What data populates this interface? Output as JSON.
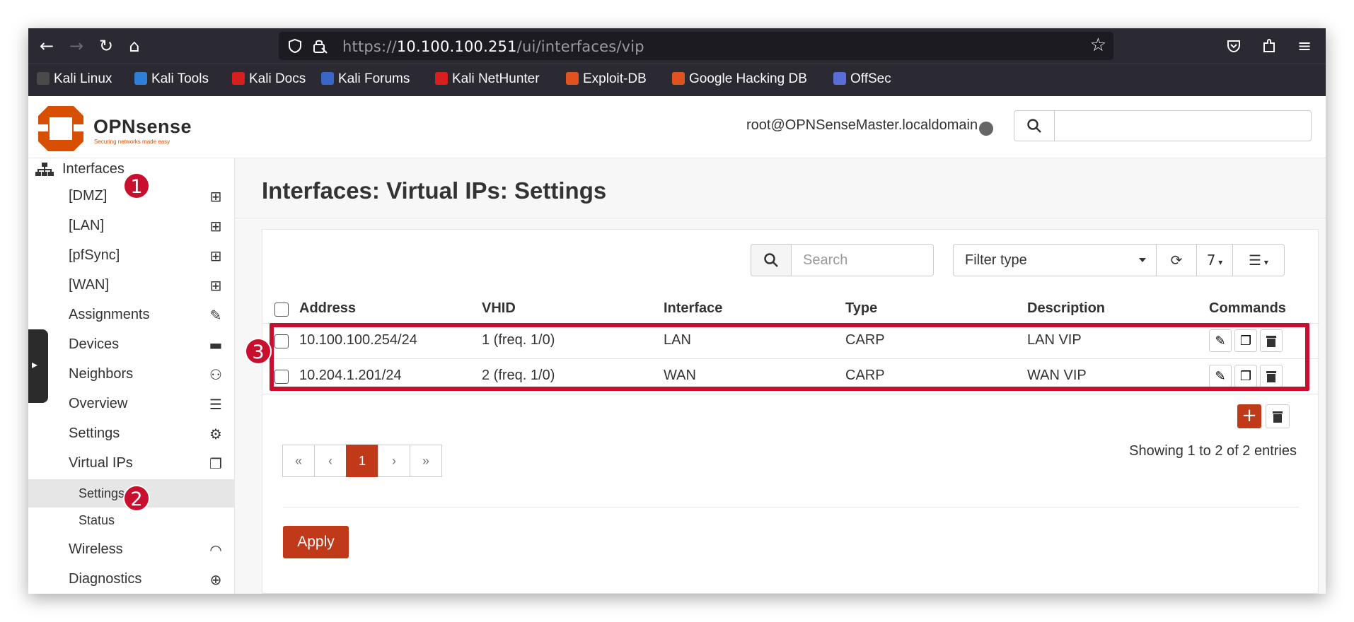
{
  "browser": {
    "url_prefix": "https://",
    "url_host": "10.100.100.251",
    "url_path": "/ui/interfaces/vip",
    "bookmarks": [
      {
        "label": "Kali Linux",
        "color": "#4a4a4a"
      },
      {
        "label": "Kali Tools",
        "color": "#2f7fd8"
      },
      {
        "label": "Kali Docs",
        "color": "#d61f1f"
      },
      {
        "label": "Kali Forums",
        "color": "#3a66c8"
      },
      {
        "label": "Kali NetHunter",
        "color": "#d61f1f"
      },
      {
        "label": "Exploit-DB",
        "color": "#e0531f"
      },
      {
        "label": "Google Hacking DB",
        "color": "#e0531f"
      },
      {
        "label": "OffSec",
        "color": "#5a6ed8"
      }
    ]
  },
  "header": {
    "logo_name": "OPNsense",
    "logo_tagline": "Securing networks made easy",
    "user": "root@OPNSenseMaster.localdomain"
  },
  "sidebar": {
    "section": "Interfaces",
    "items": [
      {
        "label": "[DMZ]"
      },
      {
        "label": "[LAN]"
      },
      {
        "label": "[pfSync]"
      },
      {
        "label": "[WAN]"
      },
      {
        "label": "Assignments"
      },
      {
        "label": "Devices"
      },
      {
        "label": "Neighbors"
      },
      {
        "label": "Overview"
      },
      {
        "label": "Settings"
      },
      {
        "label": "Virtual IPs"
      },
      {
        "label": "Settings"
      },
      {
        "label": "Status"
      },
      {
        "label": "Wireless"
      },
      {
        "label": "Diagnostics"
      }
    ]
  },
  "main": {
    "title": "Interfaces: Virtual IPs: Settings",
    "search_placeholder": "Search",
    "filter_type": "Filter type",
    "page_size": "7",
    "columns": [
      "Address",
      "VHID",
      "Interface",
      "Type",
      "Description",
      "Commands"
    ],
    "rows": [
      {
        "address": "10.100.100.254/24",
        "vhid": "1 (freq. 1/0)",
        "interface": "LAN",
        "type": "CARP",
        "description": "LAN VIP"
      },
      {
        "address": "10.204.1.201/24",
        "vhid": "2 (freq. 1/0)",
        "interface": "WAN",
        "type": "CARP",
        "description": "WAN VIP"
      }
    ],
    "pager": {
      "first": "«",
      "prev": "‹",
      "current": "1",
      "next": "›",
      "last": "»"
    },
    "showing": "Showing 1 to 2 of 2 entries",
    "apply_label": "Apply",
    "add_label": "+"
  },
  "annotations": [
    "1",
    "2",
    "3"
  ],
  "colors": {
    "accent": "#c03a1a",
    "annotation": "#c8102e"
  }
}
